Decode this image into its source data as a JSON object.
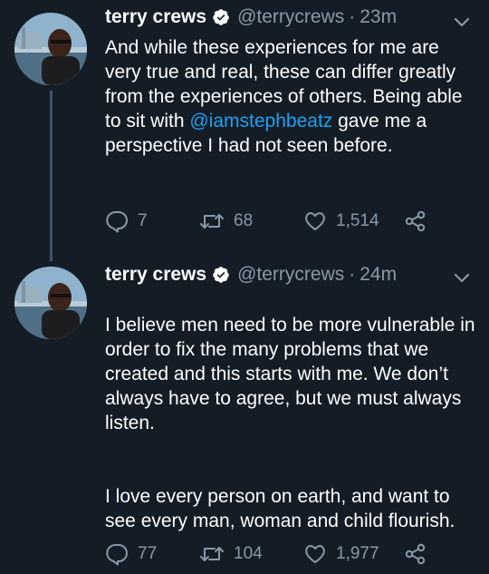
{
  "tweets": [
    {
      "display_name": "terry crews",
      "handle": "@terrycrews",
      "separator": "·",
      "time": "23m",
      "text_before_mention": "And while these experiences for me are very true and real, these can differ greatly from the experiences of others. Being able to sit with ",
      "mention": "@iamstephbeatz",
      "text_after_mention": " gave me a perspective I had not seen before.",
      "replies": "7",
      "retweets": "68",
      "likes": "1,514"
    },
    {
      "display_name": "terry crews",
      "handle": "@terrycrews",
      "separator": "·",
      "time": "24m",
      "paragraph_1": "I believe men need to be more vulnerable in order to fix the many problems that we created and this starts with me. We don’t always have to agree, but we must always listen.",
      "paragraph_2": "I love every person on earth, and want to see every man, woman and child flourish.",
      "replies": "77",
      "retweets": "104",
      "likes": "1,977"
    }
  ],
  "colors": {
    "background": "#141d26",
    "text": "#ffffff",
    "secondary_text": "#8899a6",
    "mention": "#1da1f2",
    "thread_line": "#3d5466"
  },
  "icons": [
    "verified-badge-icon",
    "chevron-down-icon",
    "reply-icon",
    "retweet-icon",
    "like-icon",
    "share-icon"
  ]
}
